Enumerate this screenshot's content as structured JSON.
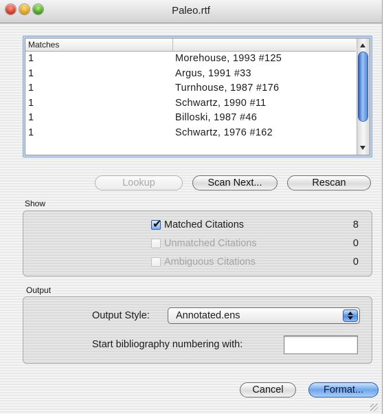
{
  "window": {
    "title": "Paleo.rtf"
  },
  "matches": {
    "header": "Matches",
    "rows": [
      {
        "count": "1",
        "citation": "Morehouse, 1993 #125"
      },
      {
        "count": "1",
        "citation": "Argus, 1991 #33"
      },
      {
        "count": "1",
        "citation": "Turnhouse, 1987 #176"
      },
      {
        "count": "1",
        "citation": "Schwartz, 1990 #11"
      },
      {
        "count": "1",
        "citation": "Billoski, 1987 #46"
      },
      {
        "count": "1",
        "citation": "Schwartz, 1976 #162"
      }
    ]
  },
  "actions": {
    "lookup": "Lookup",
    "scan_next": "Scan Next...",
    "rescan": "Rescan"
  },
  "show": {
    "label": "Show",
    "items": [
      {
        "label": "Matched Citations",
        "count": "8",
        "checked": true,
        "enabled": true
      },
      {
        "label": "Unmatched Citations",
        "count": "0",
        "checked": false,
        "enabled": false
      },
      {
        "label": "Ambiguous Citations",
        "count": "0",
        "checked": false,
        "enabled": false
      }
    ]
  },
  "output": {
    "label": "Output",
    "style_label": "Output Style:",
    "style_value": "Annotated.ens",
    "numbering_label": "Start bibliography numbering with:",
    "numbering_value": ""
  },
  "footer": {
    "cancel": "Cancel",
    "format": "Format..."
  },
  "colors": {
    "default_button": "#6ea6ec",
    "selection_frame": "#7aa3d8",
    "window_background": "#e9e9e9"
  }
}
